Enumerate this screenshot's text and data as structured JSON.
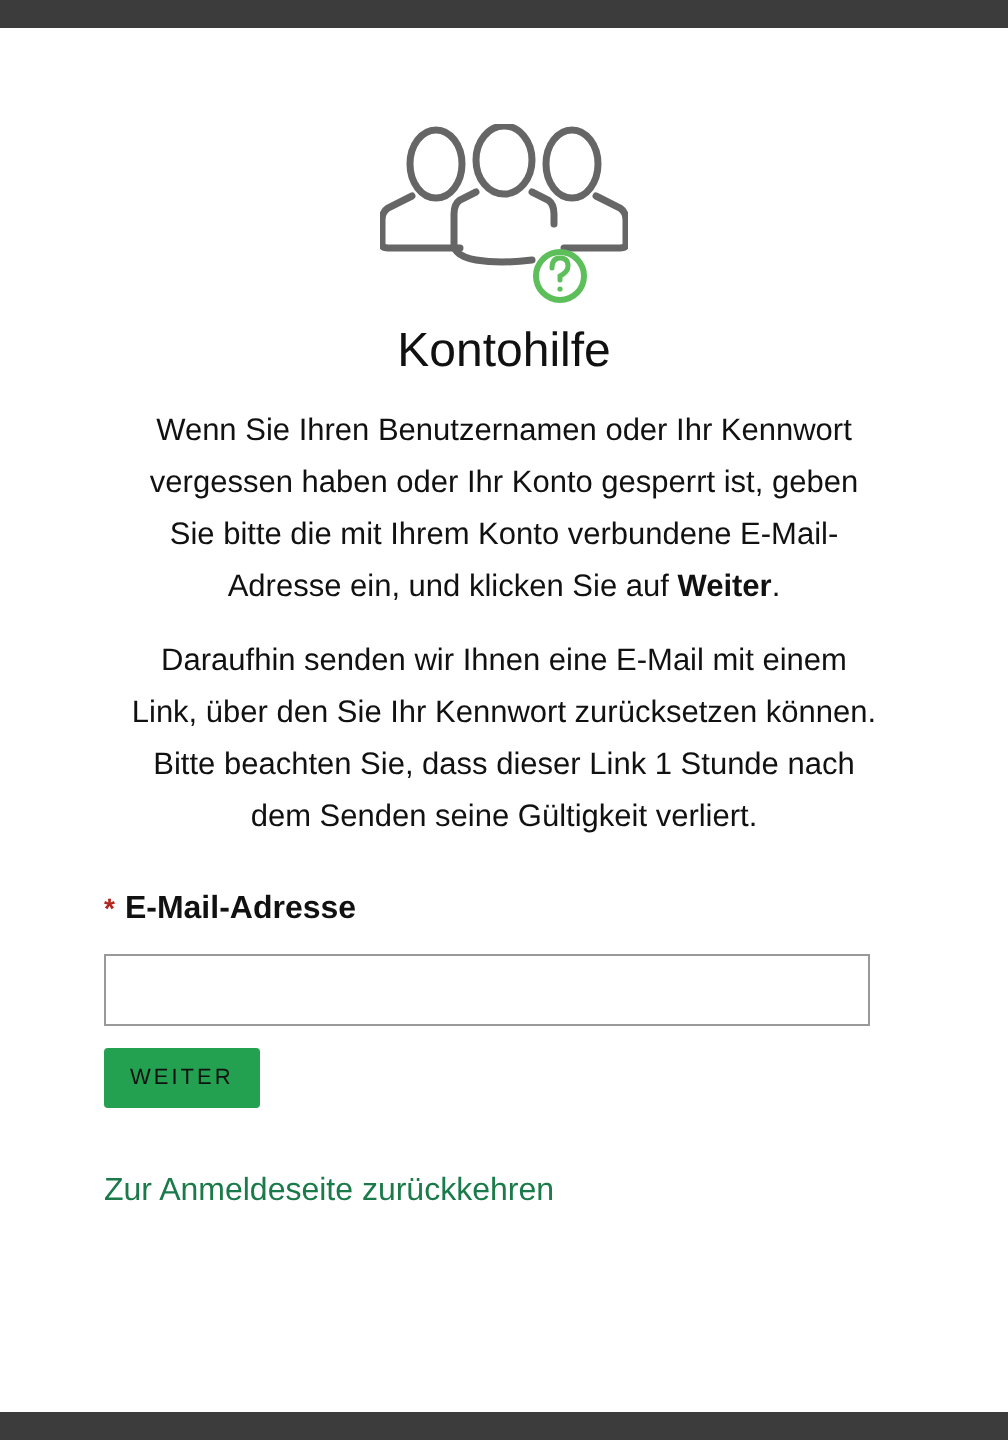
{
  "title": "Kontohilfe",
  "paragraphs": [
    "Wenn Sie Ihren Benutzernamen oder Ihr Kennwort vergessen haben oder Ihr Konto gesperrt ist, geben Sie bitte die mit Ihrem Konto verbundene E-Mail-Adresse ein, und klicken Sie auf **Weiter**.",
    "Daraufhin senden wir Ihnen eine E-Mail mit einem Link, über den Sie Ihr Kennwort zurücksetzen können. Bitte beachten Sie, dass dieser Link 1 Stunde nach dem Senden seine Gültigkeit verliert."
  ],
  "field": {
    "required_marker": "*",
    "label": "E-Mail-Adresse"
  },
  "button": "WEITER",
  "link": "Zur Anmeldeseite zurückkehren"
}
